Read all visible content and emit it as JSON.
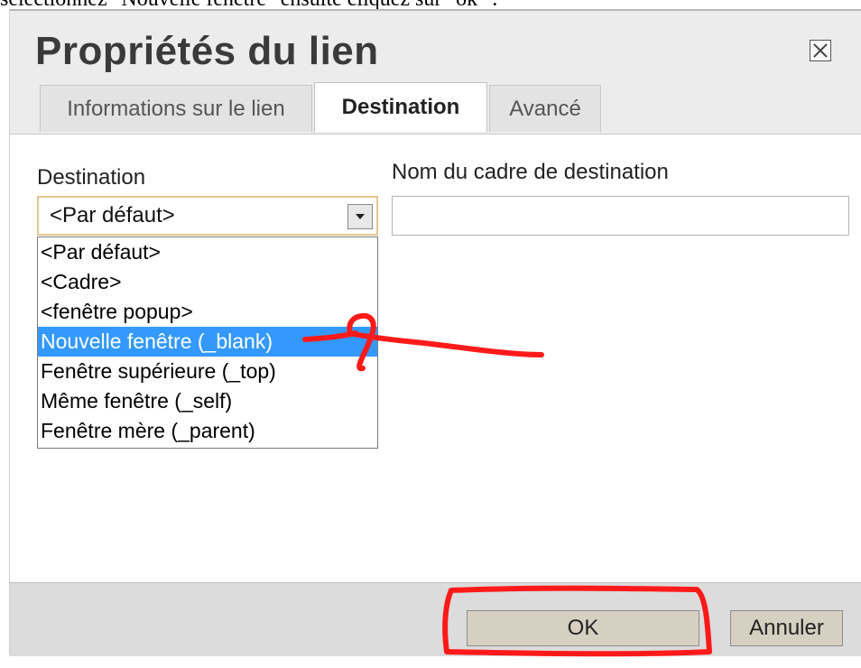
{
  "caption": "sélectionnez \"Nouvelle fenêtre\" ensuite cliquez sur \"ok\" :",
  "dialog": {
    "title": "Propriétés du lien",
    "tabs": [
      {
        "label": "Informations sur le lien",
        "active": false
      },
      {
        "label": "Destination",
        "active": true
      },
      {
        "label": "Avancé",
        "active": false
      }
    ],
    "destination_label": "Destination",
    "frame_name_label": "Nom du cadre de destination",
    "frame_name_value": "",
    "select_value": "<Par défaut>",
    "options": [
      "<Par défaut>",
      "<Cadre>",
      "<fenêtre popup>",
      "Nouvelle fenêtre (_blank)",
      "Fenêtre supérieure (_top)",
      "Même fenêtre (_self)",
      "Fenêtre mère (_parent)"
    ],
    "selected_option": "Nouvelle fenêtre (_blank)",
    "ok_label": "OK",
    "cancel_label": "Annuler"
  },
  "colors": {
    "highlight": "#3399ff",
    "annotation": "#ff1a1a",
    "select_border": "#e2c88e"
  }
}
